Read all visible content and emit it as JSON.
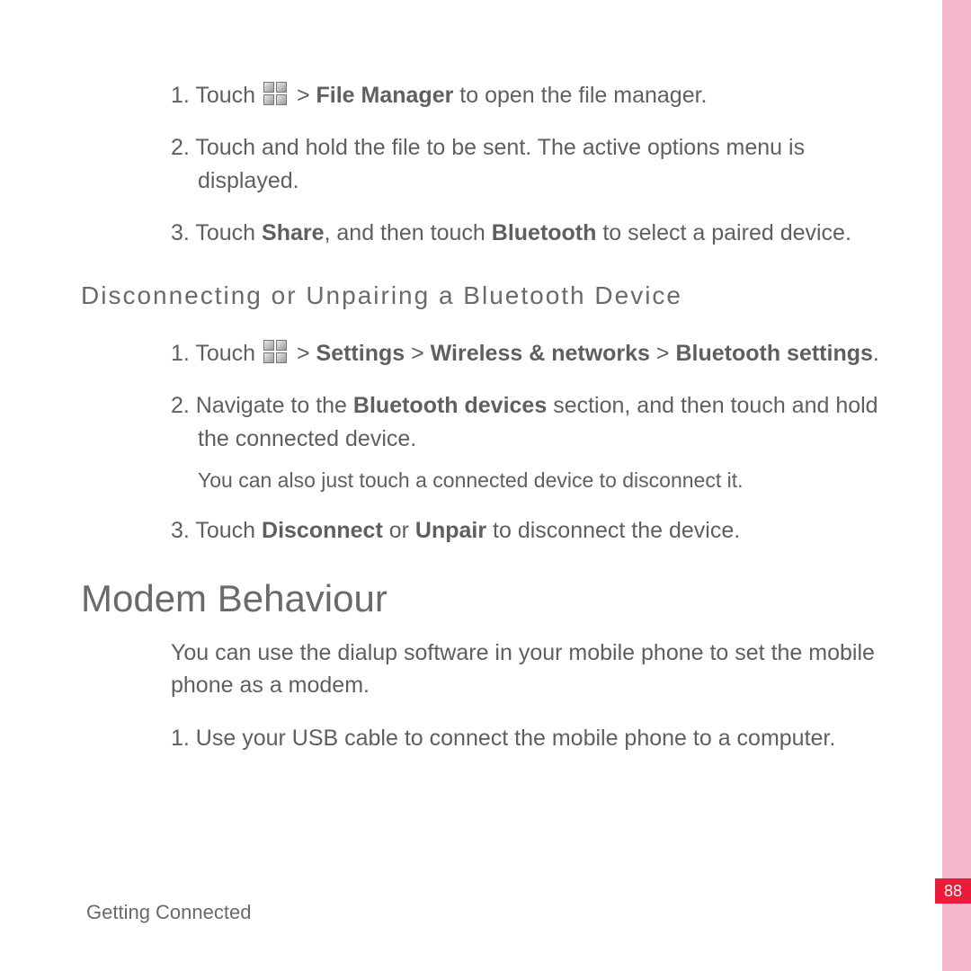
{
  "steps_a": {
    "s1_num": "1. ",
    "s1_pre": "Touch ",
    "s1_post": " > ",
    "s1_bold": "File Manager",
    "s1_tail": " to open the file manager.",
    "s2_num": "2. ",
    "s2_text": "Touch and hold the file to be sent. The active options menu is displayed.",
    "s3_num": "3. ",
    "s3_pre": "Touch ",
    "s3_b1": "Share",
    "s3_mid": ", and then touch ",
    "s3_b2": "Bluetooth",
    "s3_tail": " to select a paired device."
  },
  "sub_heading": "Disconnecting or Unpairing a Bluetooth Device",
  "steps_b": {
    "s1_num": "1. ",
    "s1_pre": "Touch ",
    "s1_post": " > ",
    "s1_b1": "Settings",
    "s1_sep1": " > ",
    "s1_b2": "Wireless & networks",
    "s1_sep2": " > ",
    "s1_b3": "Bluetooth settings",
    "s1_tail": ".",
    "s2_num": "2. ",
    "s2_pre": "Navigate to the ",
    "s2_b1": "Bluetooth devices",
    "s2_tail": " section, and then touch and hold the connected device.",
    "note": "You can also just touch a connected device to disconnect it.",
    "s3_num": "3. ",
    "s3_pre": "Touch ",
    "s3_b1": "Disconnect",
    "s3_mid": " or ",
    "s3_b2": "Unpair",
    "s3_tail": " to disconnect the device."
  },
  "main_heading": "Modem Behaviour",
  "modem": {
    "intro": "You can use the dialup software in your mobile phone to set the mobile phone as a modem.",
    "s1_num": "1. ",
    "s1_text": "Use your USB cable to connect the mobile phone to a computer."
  },
  "footer": "Getting Connected",
  "page_number": "88"
}
